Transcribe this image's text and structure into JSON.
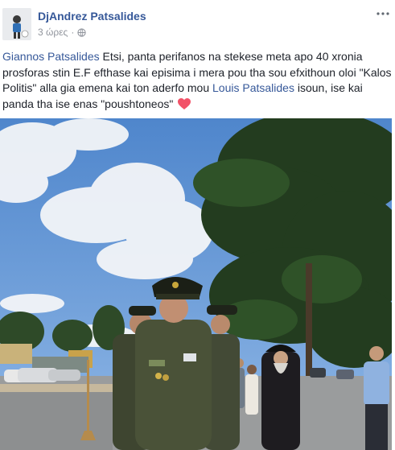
{
  "post": {
    "author": "DjAndrez Patsalides",
    "time": "3 ώρες",
    "separator": "·",
    "privacy_icon": "globe-icon",
    "more_icon": "more-options-icon",
    "text": {
      "mention_1": "Giannos Patsalides",
      "part_1": " Etsi, panta perifanos na stekese meta apo 40 xronia prosforas stin E.F efthase kai episima i mera pou tha sou efxithoun oloi \"Kalos Politis\" alla gia emena kai ton aderfo mou ",
      "mention_2": "Louis Patsalides",
      "part_2": " isoun, ise kai panda tha ise enas \"poushtoneos\" ",
      "emoji": "heart-icon"
    }
  },
  "colors": {
    "link": "#365899",
    "meta": "#90949c",
    "text": "#1d2129",
    "heart": "#f25268",
    "sky": "#5f95d6"
  }
}
